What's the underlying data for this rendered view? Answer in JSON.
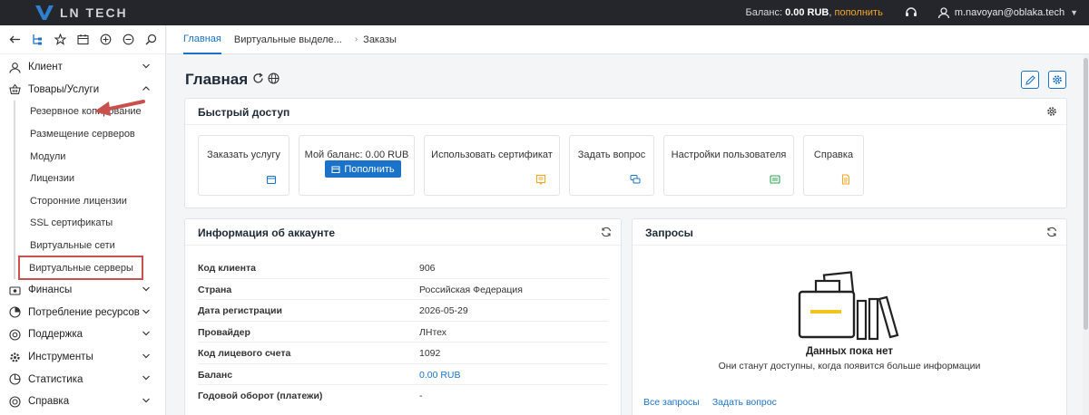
{
  "topbar": {
    "logo_text": "LN TECH",
    "balance_label": "Баланс:",
    "balance_value": "0.00 RUB",
    "balance_separator": ",",
    "topup_link": "пополнить",
    "user_email": "m.navoyan@oblaka.tech",
    "colors": {
      "background": "#24262b",
      "accent": "#f5a623"
    }
  },
  "sidebar": {
    "tools": [
      "back-icon",
      "tree-icon",
      "star-icon",
      "calendar-icon",
      "zoom-in-icon",
      "zoom-out-icon",
      "search-icon"
    ],
    "items": [
      {
        "label": "Клиент",
        "icon": "user-icon",
        "expanded": false
      },
      {
        "label": "Товары/Услуги",
        "icon": "basket-icon",
        "expanded": true,
        "children": [
          "Резервное копирование",
          "Размещение серверов",
          "Модули",
          "Лицензии",
          "Сторонние лицензии",
          "SSL сертификаты",
          "Виртуальные сети",
          "Виртуальные серверы"
        ]
      },
      {
        "label": "Финансы",
        "icon": "finance-icon",
        "expanded": false
      },
      {
        "label": "Потребление ресурсов",
        "icon": "resources-icon",
        "expanded": false
      },
      {
        "label": "Поддержка",
        "icon": "support-icon",
        "expanded": false
      },
      {
        "label": "Инструменты",
        "icon": "tools-icon",
        "expanded": false
      },
      {
        "label": "Статистика",
        "icon": "stats-icon",
        "expanded": false
      },
      {
        "label": "Справка",
        "icon": "help-icon",
        "expanded": false
      }
    ],
    "highlight_color": "#c9504c"
  },
  "breadcrumbs": {
    "tabs": [
      "Главная",
      "Виртуальные выделе...",
      "Заказы"
    ],
    "active_index": 0
  },
  "main": {
    "title": "Главная",
    "quick_access": {
      "title": "Быстрый доступ",
      "tiles": [
        {
          "label": "Заказать услугу",
          "icon": "box-icon"
        },
        {
          "label": "Мой баланс: 0.00 RUB",
          "button": "Пополнить"
        },
        {
          "label": "Использовать сертификат",
          "icon": "certificate-icon"
        },
        {
          "label": "Задать вопрос",
          "icon": "chat-icon"
        },
        {
          "label": "Настройки пользователя",
          "icon": "settings-card-icon"
        },
        {
          "label": "Справка",
          "icon": "document-icon"
        }
      ]
    },
    "account_info": {
      "title": "Информация об аккаунте",
      "rows": [
        {
          "key": "Код клиента",
          "value": "906"
        },
        {
          "key": "Страна",
          "value": "Российская Федерация"
        },
        {
          "key": "Дата регистрации",
          "value": "2026-05-29"
        },
        {
          "key": "Провайдер",
          "value": "ЛНтех"
        },
        {
          "key": "Код лицевого счета",
          "value": "1092"
        },
        {
          "key": "Баланс",
          "value": "0.00 RUB",
          "link": true
        },
        {
          "key": "Годовой оборот (платежи)",
          "value": "-"
        }
      ]
    },
    "requests": {
      "title": "Запросы",
      "empty_title": "Данных пока нет",
      "empty_subtitle": "Они станут доступны, когда появится больше информации",
      "links": [
        "Все запросы",
        "Задать вопрос"
      ]
    },
    "accent": "#1a73c9"
  }
}
